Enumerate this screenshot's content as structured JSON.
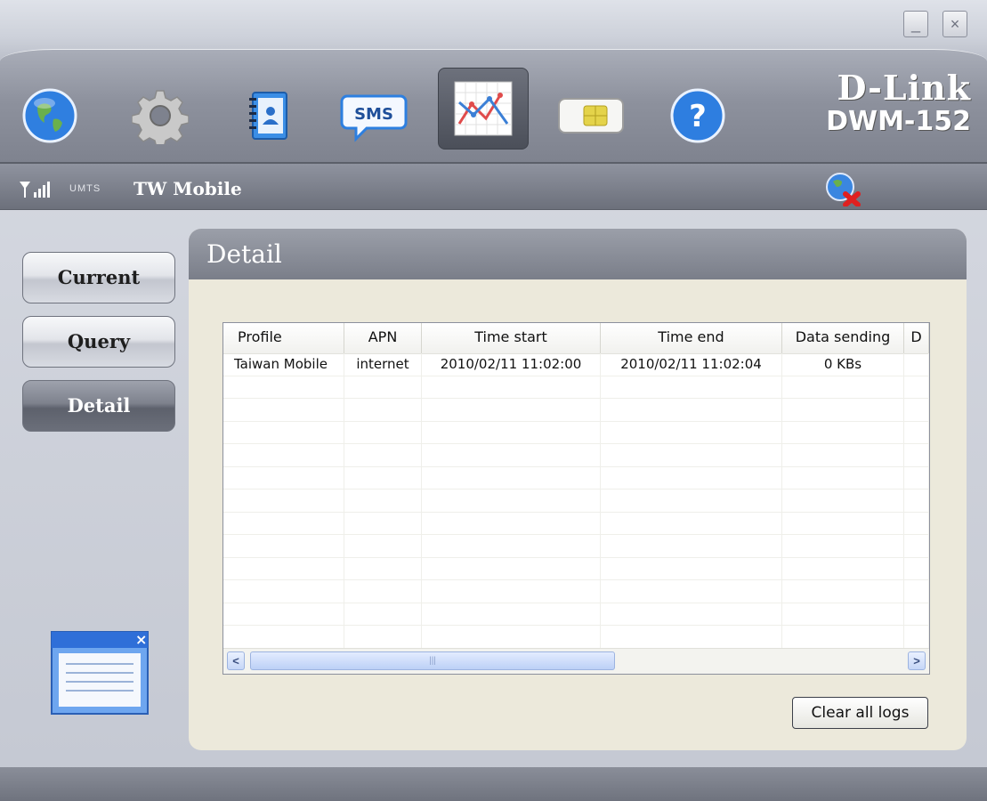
{
  "window": {
    "minimize_glyph": "_",
    "close_glyph": "×"
  },
  "toolbar": {
    "items": [
      {
        "name": "internet-globe-icon"
      },
      {
        "name": "settings-gear-icon"
      },
      {
        "name": "phonebook-icon"
      },
      {
        "name": "sms-icon",
        "label": "SMS"
      },
      {
        "name": "statistics-chart-icon",
        "active": true
      },
      {
        "name": "sim-card-icon"
      },
      {
        "name": "help-icon",
        "label": "?"
      }
    ]
  },
  "brand": {
    "logo": "D-Link",
    "model": "DWM-152"
  },
  "status": {
    "signal_icon": "signal-strength-icon",
    "network_type": "UMTS",
    "carrier": "TW Mobile"
  },
  "nav": {
    "items": [
      {
        "label": "Current",
        "active": false
      },
      {
        "label": "Query",
        "active": false
      },
      {
        "label": "Detail",
        "active": true
      }
    ]
  },
  "panel": {
    "title": "Detail"
  },
  "table": {
    "columns": [
      "Profile",
      "APN",
      "Time start",
      "Time end",
      "Data sending",
      "D"
    ],
    "rows": [
      [
        "Taiwan Mobile",
        "internet",
        "2010/02/11 11:02:00",
        "2010/02/11 11:02:04",
        "0 KBs",
        ""
      ]
    ],
    "scroll_thumb_grip": "|||",
    "scroll_left": "<",
    "scroll_right": ">"
  },
  "actions": {
    "clear_logs": "Clear all logs"
  },
  "colors": {
    "panel_bg": "#ece9db",
    "toolbar_bg": "#8d919d",
    "accent_blue": "#2f6fd8"
  }
}
